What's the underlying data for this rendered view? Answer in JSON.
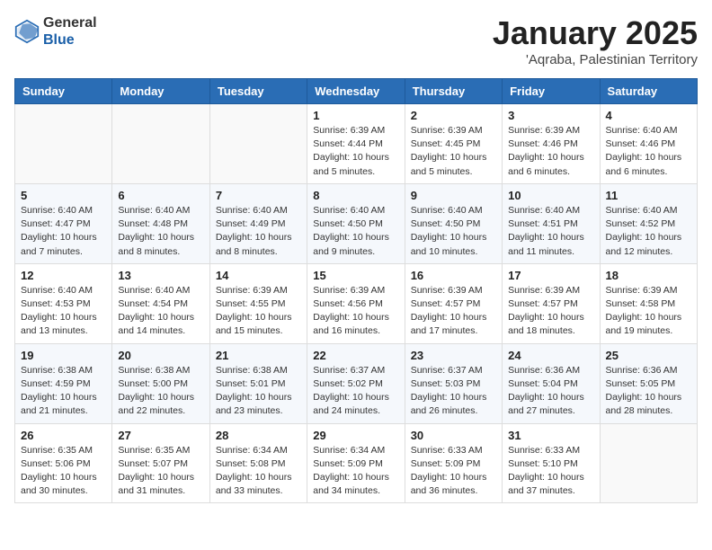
{
  "header": {
    "logo_general": "General",
    "logo_blue": "Blue",
    "month_year": "January 2025",
    "location": "'Aqraba, Palestinian Territory"
  },
  "calendar": {
    "headers": [
      "Sunday",
      "Monday",
      "Tuesday",
      "Wednesday",
      "Thursday",
      "Friday",
      "Saturday"
    ],
    "weeks": [
      [
        {
          "day": "",
          "info": ""
        },
        {
          "day": "",
          "info": ""
        },
        {
          "day": "",
          "info": ""
        },
        {
          "day": "1",
          "info": "Sunrise: 6:39 AM\nSunset: 4:44 PM\nDaylight: 10 hours\nand 5 minutes."
        },
        {
          "day": "2",
          "info": "Sunrise: 6:39 AM\nSunset: 4:45 PM\nDaylight: 10 hours\nand 5 minutes."
        },
        {
          "day": "3",
          "info": "Sunrise: 6:39 AM\nSunset: 4:46 PM\nDaylight: 10 hours\nand 6 minutes."
        },
        {
          "day": "4",
          "info": "Sunrise: 6:40 AM\nSunset: 4:46 PM\nDaylight: 10 hours\nand 6 minutes."
        }
      ],
      [
        {
          "day": "5",
          "info": "Sunrise: 6:40 AM\nSunset: 4:47 PM\nDaylight: 10 hours\nand 7 minutes."
        },
        {
          "day": "6",
          "info": "Sunrise: 6:40 AM\nSunset: 4:48 PM\nDaylight: 10 hours\nand 8 minutes."
        },
        {
          "day": "7",
          "info": "Sunrise: 6:40 AM\nSunset: 4:49 PM\nDaylight: 10 hours\nand 8 minutes."
        },
        {
          "day": "8",
          "info": "Sunrise: 6:40 AM\nSunset: 4:50 PM\nDaylight: 10 hours\nand 9 minutes."
        },
        {
          "day": "9",
          "info": "Sunrise: 6:40 AM\nSunset: 4:50 PM\nDaylight: 10 hours\nand 10 minutes."
        },
        {
          "day": "10",
          "info": "Sunrise: 6:40 AM\nSunset: 4:51 PM\nDaylight: 10 hours\nand 11 minutes."
        },
        {
          "day": "11",
          "info": "Sunrise: 6:40 AM\nSunset: 4:52 PM\nDaylight: 10 hours\nand 12 minutes."
        }
      ],
      [
        {
          "day": "12",
          "info": "Sunrise: 6:40 AM\nSunset: 4:53 PM\nDaylight: 10 hours\nand 13 minutes."
        },
        {
          "day": "13",
          "info": "Sunrise: 6:40 AM\nSunset: 4:54 PM\nDaylight: 10 hours\nand 14 minutes."
        },
        {
          "day": "14",
          "info": "Sunrise: 6:39 AM\nSunset: 4:55 PM\nDaylight: 10 hours\nand 15 minutes."
        },
        {
          "day": "15",
          "info": "Sunrise: 6:39 AM\nSunset: 4:56 PM\nDaylight: 10 hours\nand 16 minutes."
        },
        {
          "day": "16",
          "info": "Sunrise: 6:39 AM\nSunset: 4:57 PM\nDaylight: 10 hours\nand 17 minutes."
        },
        {
          "day": "17",
          "info": "Sunrise: 6:39 AM\nSunset: 4:57 PM\nDaylight: 10 hours\nand 18 minutes."
        },
        {
          "day": "18",
          "info": "Sunrise: 6:39 AM\nSunset: 4:58 PM\nDaylight: 10 hours\nand 19 minutes."
        }
      ],
      [
        {
          "day": "19",
          "info": "Sunrise: 6:38 AM\nSunset: 4:59 PM\nDaylight: 10 hours\nand 21 minutes."
        },
        {
          "day": "20",
          "info": "Sunrise: 6:38 AM\nSunset: 5:00 PM\nDaylight: 10 hours\nand 22 minutes."
        },
        {
          "day": "21",
          "info": "Sunrise: 6:38 AM\nSunset: 5:01 PM\nDaylight: 10 hours\nand 23 minutes."
        },
        {
          "day": "22",
          "info": "Sunrise: 6:37 AM\nSunset: 5:02 PM\nDaylight: 10 hours\nand 24 minutes."
        },
        {
          "day": "23",
          "info": "Sunrise: 6:37 AM\nSunset: 5:03 PM\nDaylight: 10 hours\nand 26 minutes."
        },
        {
          "day": "24",
          "info": "Sunrise: 6:36 AM\nSunset: 5:04 PM\nDaylight: 10 hours\nand 27 minutes."
        },
        {
          "day": "25",
          "info": "Sunrise: 6:36 AM\nSunset: 5:05 PM\nDaylight: 10 hours\nand 28 minutes."
        }
      ],
      [
        {
          "day": "26",
          "info": "Sunrise: 6:35 AM\nSunset: 5:06 PM\nDaylight: 10 hours\nand 30 minutes."
        },
        {
          "day": "27",
          "info": "Sunrise: 6:35 AM\nSunset: 5:07 PM\nDaylight: 10 hours\nand 31 minutes."
        },
        {
          "day": "28",
          "info": "Sunrise: 6:34 AM\nSunset: 5:08 PM\nDaylight: 10 hours\nand 33 minutes."
        },
        {
          "day": "29",
          "info": "Sunrise: 6:34 AM\nSunset: 5:09 PM\nDaylight: 10 hours\nand 34 minutes."
        },
        {
          "day": "30",
          "info": "Sunrise: 6:33 AM\nSunset: 5:09 PM\nDaylight: 10 hours\nand 36 minutes."
        },
        {
          "day": "31",
          "info": "Sunrise: 6:33 AM\nSunset: 5:10 PM\nDaylight: 10 hours\nand 37 minutes."
        },
        {
          "day": "",
          "info": ""
        }
      ]
    ]
  }
}
